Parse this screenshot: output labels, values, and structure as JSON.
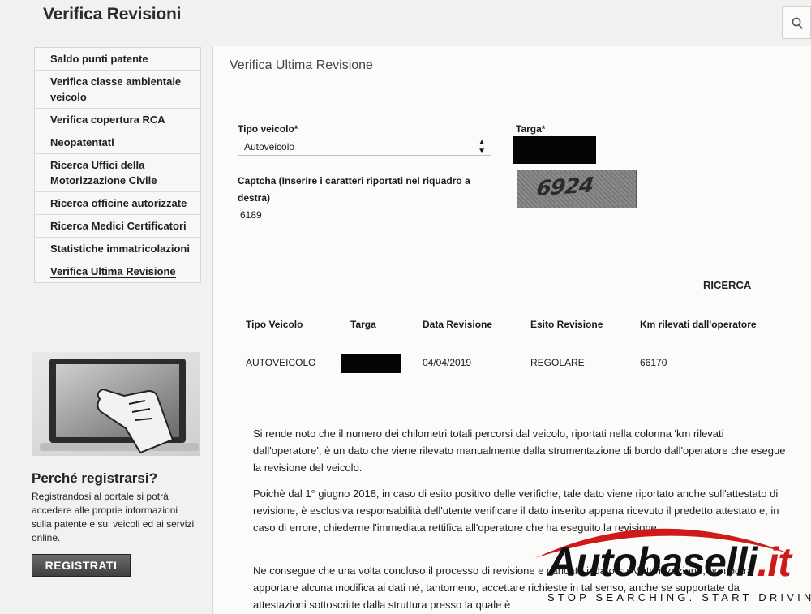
{
  "header": {
    "title": "Verifica Revisioni",
    "search_icon": "search-icon"
  },
  "sidebar": {
    "items": [
      {
        "label": "Saldo punti patente"
      },
      {
        "label": "Verifica classe ambientale veicolo"
      },
      {
        "label": "Verifica copertura RCA"
      },
      {
        "label": "Neopatentati"
      },
      {
        "label": "Ricerca Uffici della Motorizzazione Civile"
      },
      {
        "label": "Ricerca officine autorizzate"
      },
      {
        "label": "Ricerca Medici Certificatori"
      },
      {
        "label": "Statistiche immatricolazioni"
      },
      {
        "label": "Verifica Ultima Revisione",
        "active": true
      }
    ]
  },
  "promo": {
    "title": "Perché registrarsi?",
    "text": "Registrandosi al portale si potrà accedere alle proprie informazioni sulla patente e sui  veicoli ed ai servizi online.",
    "button": "REGISTRATI"
  },
  "form": {
    "section_title": "Verifica Ultima Revisione",
    "tipo_label": "Tipo veicolo*",
    "tipo_value": "Autoveicolo",
    "targa_label": "Targa*",
    "captcha_label": "Captcha (Inserire i caratteri riportati nel riquadro a destra)",
    "captcha_value": "6189",
    "captcha_image_text": "6924",
    "search_button": "RICERCA"
  },
  "results": {
    "columns": [
      "Tipo Veicolo",
      "Targa",
      "Data Revisione",
      "Esito Revisione",
      "Km rilevati dall'operatore"
    ],
    "row": {
      "tipo": "AUTOVEICOLO",
      "data": "04/04/2019",
      "esito": "REGOLARE",
      "km": "66170"
    }
  },
  "notes": [
    "Si rende noto che il numero dei chilometri totali percorsi dal veicolo, riportati nella colonna 'km rilevati dall'operatore', è un dato che viene rilevato manualmente dalla strumentazione di bordo dall'operatore che esegue la revisione del veicolo.",
    "Poichè dal 1° giugno 2018, in caso di esito positivo delle verifiche, tale dato viene riportato anche sull'attestato di revisione, è esclusiva responsabilità dell'utente verificare il dato inserito appena ricevuto il predetto attestato e, in caso di errore, chiederne l'immediata rettifica all'operatore che ha eseguito la revisione.",
    "Ne consegue che una volta concluso il processo di revisione e caricato il dato su Motorizzazione, non potrà apportare alcuna modifica ai dati né, tantomeno, accettare richieste in tal senso, anche se supportate da attestazioni sottoscritte dalla struttura presso la quale è"
  ],
  "watermark": {
    "brand": "Autobaselli",
    "tld": "it",
    "tagline": "STOP SEARCHING. START DRIVING."
  },
  "colors": {
    "watermark_red": "#d01a1a",
    "redaction": "#050505"
  }
}
